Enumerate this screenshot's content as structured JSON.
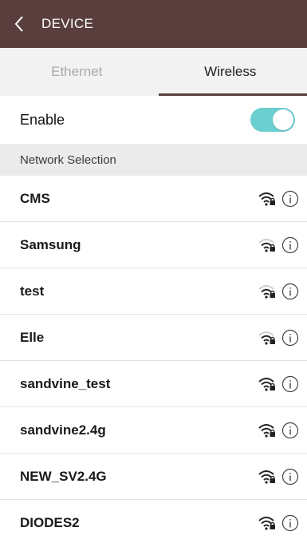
{
  "header": {
    "title": "DEVICE",
    "back_icon": "chevron-left-icon"
  },
  "tabs": [
    {
      "label": "Ethernet",
      "active": false
    },
    {
      "label": "Wireless",
      "active": true
    }
  ],
  "enable": {
    "label": "Enable",
    "state": "on",
    "toggle_color": "#6ccfcf"
  },
  "section": {
    "title": "Network Selection"
  },
  "networks": [
    {
      "name": "CMS",
      "signal": "strong"
    },
    {
      "name": "Samsung",
      "signal": "weak"
    },
    {
      "name": "test",
      "signal": "weak"
    },
    {
      "name": "Elle",
      "signal": "weak"
    },
    {
      "name": "sandvine_test",
      "signal": "strong"
    },
    {
      "name": "sandvine2.4g",
      "signal": "strong"
    },
    {
      "name": "NEW_SV2.4G",
      "signal": "strong"
    },
    {
      "name": "DIODES2",
      "signal": "strong"
    }
  ],
  "colors": {
    "brand": "#5a3e3e",
    "accent": "#6ccfcf"
  }
}
